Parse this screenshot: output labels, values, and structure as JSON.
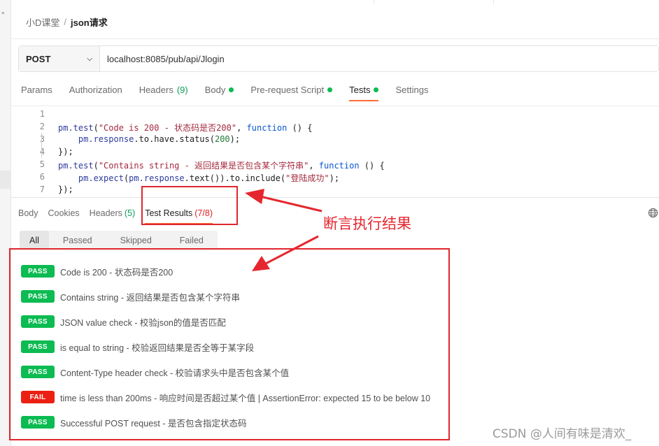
{
  "sidebar": {
    "marker": "°"
  },
  "breadcrumb": {
    "collection": "小D课堂",
    "separator": "/",
    "request": "json请求"
  },
  "request": {
    "method": "POST",
    "url": "localhost:8085/pub/api/Jlogin"
  },
  "request_tabs": [
    {
      "label": "Params",
      "count": "",
      "dot": false,
      "active": false
    },
    {
      "label": "Authorization",
      "count": "",
      "dot": false,
      "active": false
    },
    {
      "label": "Headers",
      "count": "(9)",
      "dot": false,
      "active": false
    },
    {
      "label": "Body",
      "count": "",
      "dot": true,
      "active": false
    },
    {
      "label": "Pre-request Script",
      "count": "",
      "dot": true,
      "active": false
    },
    {
      "label": "Tests",
      "count": "",
      "dot": true,
      "active": true
    },
    {
      "label": "Settings",
      "count": "",
      "dot": false,
      "active": false
    }
  ],
  "editor": {
    "line_numbers": [
      "1",
      "2",
      "3",
      "4",
      "5",
      "6",
      "7"
    ],
    "lines": [
      "",
      "pm.test(\"Code is 200 - 状态码是否200\", function () {",
      "    pm.response.to.have.status(200);",
      "});",
      "pm.test(\"Contains string - 返回结果是否包含某个字符串\", function () {",
      "    pm.expect(pm.response.text()).to.include(\"登陆成功\");",
      "});"
    ]
  },
  "response_tabs": [
    {
      "label": "Body",
      "count": "",
      "active": false
    },
    {
      "label": "Cookies",
      "count": "",
      "active": false
    },
    {
      "label": "Headers",
      "count": "(5)",
      "active": false
    },
    {
      "label": "Test Results",
      "count": "(7/8)",
      "active": true
    }
  ],
  "filters": [
    "All",
    "Passed",
    "Skipped",
    "Failed"
  ],
  "results": [
    {
      "status": "PASS",
      "text": "Code is 200 - 状态码是否200"
    },
    {
      "status": "PASS",
      "text": "Contains string - 返回结果是否包含某个字符串"
    },
    {
      "status": "PASS",
      "text": "JSON value check - 校验json的值是否匹配"
    },
    {
      "status": "PASS",
      "text": "is equal to string - 校验返回结果是否全等于某字段"
    },
    {
      "status": "PASS",
      "text": "Content-Type header check - 校验请求头中是否包含某个值"
    },
    {
      "status": "FAIL",
      "text": "time is less than 200ms - 响应时间是否超过某个值 | AssertionError: expected 15 to be below 10"
    },
    {
      "status": "PASS",
      "text": "Successful POST request - 是否包含指定状态码"
    }
  ],
  "annotation": {
    "text": "断言执行结果",
    "color": "#e6262f"
  },
  "watermark": "CSDN @人间有味是清欢_",
  "colors": {
    "accent": "#ff6c37",
    "pass": "#0cbb52",
    "fail": "#eb2013"
  },
  "icons": {
    "method_dropdown": "chevron-down-icon",
    "globe": "globe-icon"
  }
}
